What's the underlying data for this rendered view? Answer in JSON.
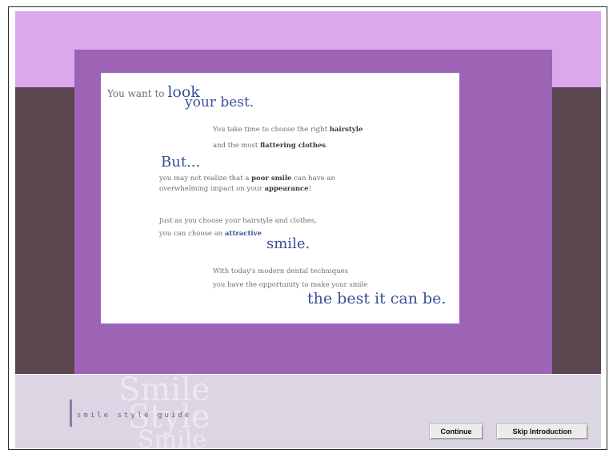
{
  "colors": {
    "top_band": "#dba8ee",
    "side_band": "#5c4650",
    "panel": "#9d64b5",
    "card": "#ffffff",
    "footer": "#dcd5e4",
    "accent_text": "#3a4f9a"
  },
  "intro": {
    "line1_pre": "You want to ",
    "line1_emph": "look",
    "line2": "your best.",
    "line3_pre": "You take time to choose the right ",
    "line3_bold": "hairstyle",
    "line4_pre": "and the most ",
    "line4_bold": "flattering clothes",
    "line4_post": ".",
    "but": "But...",
    "line5_pre": "you may not realize that a ",
    "line5_bold": "poor smile",
    "line5_post": " can have an",
    "line6_pre": "overwhelming impact on your ",
    "line6_bold": "appearance",
    "line6_post": "!",
    "line7": "Just as you choose your hairstyle and clothes,",
    "line8_pre": "you can choose an ",
    "line8_bold": "attractive",
    "smile": "smile.",
    "line9": "With today's modern dental techniques",
    "line10": "you have the opportunity to make your smile",
    "closing": "the best it can be."
  },
  "footer": {
    "bg_word1": "Smile",
    "bg_word2": "Style",
    "bg_word3": "Smile",
    "brand": "smile style guide",
    "continue_label": "Continue",
    "skip_label": "Skip Introduction"
  }
}
